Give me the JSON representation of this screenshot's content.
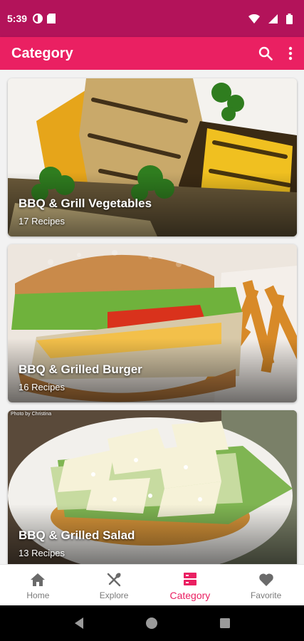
{
  "status_bar": {
    "time": "5:39"
  },
  "app_bar": {
    "title": "Category"
  },
  "cards": [
    {
      "title": "BBQ & Grill Vegetables",
      "subtitle": "17 Recipes"
    },
    {
      "title": "BBQ & Grilled Burger",
      "subtitle": "16 Recipes"
    },
    {
      "title": "BBQ & Grilled Salad",
      "subtitle": "13 Recipes",
      "photo_credit": "Photo by Christina"
    }
  ],
  "bottom_nav": {
    "items": [
      {
        "label": "Home",
        "icon": "home-icon"
      },
      {
        "label": "Explore",
        "icon": "fork-knife-icon"
      },
      {
        "label": "Category",
        "icon": "category-icon"
      },
      {
        "label": "Favorite",
        "icon": "heart-icon"
      }
    ],
    "active": "Category"
  },
  "colors": {
    "status_bar": "#b3135a",
    "app_bar": "#ea2062",
    "accent": "#ea2062",
    "inactive": "#7a7a7a"
  }
}
